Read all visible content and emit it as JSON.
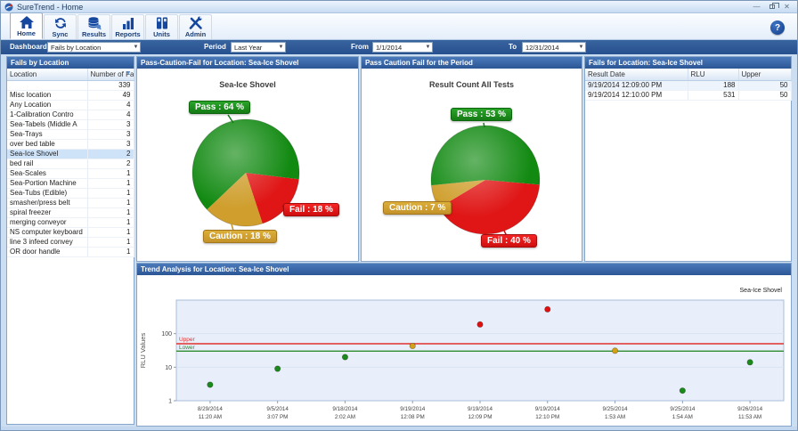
{
  "window": {
    "title": "SureTrend - Home"
  },
  "toolbar": {
    "tabs": [
      {
        "label": "Home",
        "active": true
      },
      {
        "label": "Sync"
      },
      {
        "label": "Results"
      },
      {
        "label": "Reports"
      },
      {
        "label": "Units"
      },
      {
        "label": "Admin"
      }
    ],
    "help": "?"
  },
  "filter_bar": {
    "dashboard_label": "Dashboard",
    "dashboard_value": "Fails by Location",
    "period_label": "Period",
    "period_value": "Last Year",
    "from_label": "From",
    "from_value": "1/1/2014",
    "to_label": "To",
    "to_value": "12/31/2014"
  },
  "fails_by_location": {
    "header": "Fails by Location",
    "columns": [
      "Location",
      "Number of Fails"
    ],
    "selected_row": "Sea-Ice Shovel",
    "rows": [
      [
        "",
        339
      ],
      [
        "Misc location",
        49
      ],
      [
        "Any Location",
        4
      ],
      [
        "1-Calibration Contro",
        4
      ],
      [
        "Sea-Tabels (Middle A",
        3
      ],
      [
        "Sea-Trays",
        3
      ],
      [
        "over bed table",
        3
      ],
      [
        "Sea-Ice Shovel",
        2
      ],
      [
        "bed rail",
        2
      ],
      [
        "Sea-Scales",
        1
      ],
      [
        "Sea-Portion Machine",
        1
      ],
      [
        "Sea-Tubs (Edible)",
        1
      ],
      [
        "smasher/press belt",
        1
      ],
      [
        "spiral freezer",
        1
      ],
      [
        "merging conveyor",
        1
      ],
      [
        "NS computer keyboard",
        1
      ],
      [
        "line 3 infeed convey",
        1
      ],
      [
        "OR door handle",
        1
      ]
    ]
  },
  "pie_location_panel": {
    "header": "Pass-Caution-Fail for Location: Sea-Ice Shovel"
  },
  "pie_period_panel": {
    "header": "Pass Caution Fail for the Period"
  },
  "fails_for_location": {
    "header": "Fails for Location: Sea-Ice Shovel",
    "columns": [
      "Result Date",
      "RLU",
      "Upper"
    ],
    "rows": [
      [
        "9/19/2014 12:09:00 PM",
        188,
        50
      ],
      [
        "9/19/2014 12:10:00 PM",
        531,
        50
      ]
    ]
  },
  "trend_panel": {
    "header": "Trend Analysis for Location: Sea-Ice Shovel"
  },
  "chart_data": [
    {
      "type": "pie",
      "title": "Sea-Ice Shovel",
      "start_angle_deg": 97,
      "slices": [
        {
          "name": "Fail",
          "pct": 18,
          "color": "#e01616",
          "label": "Fail : 18 %"
        },
        {
          "name": "Caution",
          "pct": 18,
          "color": "#cf9e2c",
          "label": "Caution : 18 %"
        },
        {
          "name": "Pass",
          "pct": 64,
          "color": "#128a12",
          "label": "Pass : 64 %"
        }
      ]
    },
    {
      "type": "pie",
      "title": "Result Count All Tests",
      "start_angle_deg": 95,
      "slices": [
        {
          "name": "Fail",
          "pct": 40,
          "color": "#e01616",
          "label": "Fail : 40 %"
        },
        {
          "name": "Caution",
          "pct": 7,
          "color": "#cf9e2c",
          "label": "Caution : 7 %"
        },
        {
          "name": "Pass",
          "pct": 53,
          "color": "#128a12",
          "label": "Pass : 53 %"
        }
      ]
    },
    {
      "type": "scatter",
      "series_name": "Sea-Ice Shovel",
      "ylabel": "RLU Values",
      "yscale": "log",
      "ylim": [
        1,
        1000
      ],
      "yticks": [
        1,
        10,
        100
      ],
      "upper_limit": {
        "label": "Upper",
        "value": 50,
        "color": "#e03030"
      },
      "lower_limit": {
        "label": "Lower",
        "value": 30,
        "color": "#2e8b2e"
      },
      "status_colors": {
        "pass": "#1a8a1a",
        "caution": "#d4a017",
        "fail": "#dd1111"
      },
      "points": [
        {
          "date": "8/29/2014",
          "time": "11:20 AM",
          "rlu": 3,
          "status": "pass"
        },
        {
          "date": "9/5/2014",
          "time": "3:07 PM",
          "rlu": 9,
          "status": "pass"
        },
        {
          "date": "9/18/2014",
          "time": "2:02 AM",
          "rlu": 20,
          "status": "pass"
        },
        {
          "date": "9/19/2014",
          "time": "12:08 PM",
          "rlu": 43,
          "status": "caution"
        },
        {
          "date": "9/19/2014",
          "time": "12:09 PM",
          "rlu": 188,
          "status": "fail"
        },
        {
          "date": "9/19/2014",
          "time": "12:10 PM",
          "rlu": 531,
          "status": "fail"
        },
        {
          "date": "9/25/2014",
          "time": "1:53 AM",
          "rlu": 31,
          "status": "caution"
        },
        {
          "date": "9/25/2014",
          "time": "1:54 AM",
          "rlu": 2,
          "status": "pass"
        },
        {
          "date": "9/26/2014",
          "time": "11:53 AM",
          "rlu": 14,
          "status": "pass"
        }
      ]
    }
  ]
}
